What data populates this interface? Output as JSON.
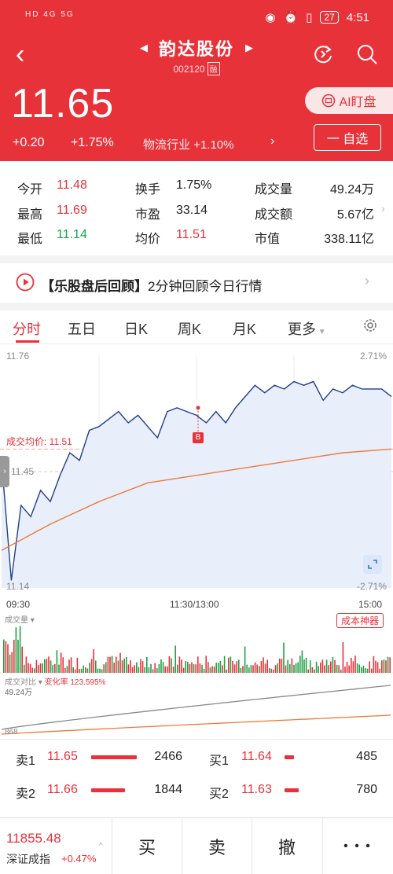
{
  "status_bar": {
    "left": "HD 4G 5G",
    "time": "4:51",
    "battery": "27"
  },
  "header": {
    "stock_name": "韵达股份",
    "stock_code": "002120",
    "margin_badge": "融",
    "price": "11.65",
    "change": "+0.20",
    "change_pct": "+1.75%",
    "industry": "物流行业",
    "industry_pct": "+1.10%",
    "ai_watch_label": "AI盯盘",
    "add_watch_label": "一 自选"
  },
  "stats": [
    {
      "label": "今开",
      "value": "11.48",
      "tone": "red"
    },
    {
      "label": "最高",
      "value": "11.69",
      "tone": "red"
    },
    {
      "label": "最低",
      "value": "11.14",
      "tone": "green"
    },
    {
      "label": "换手",
      "value": "1.75%",
      "tone": "plain"
    },
    {
      "label": "市盈",
      "value": "33.14",
      "tone": "plain"
    },
    {
      "label": "均价",
      "value": "11.51",
      "tone": "red"
    },
    {
      "label": "成交量",
      "value": "49.24万",
      "tone": "plain"
    },
    {
      "label": "成交额",
      "value": "5.67亿",
      "tone": "plain"
    },
    {
      "label": "市值",
      "value": "338.11亿",
      "tone": "plain"
    }
  ],
  "review": {
    "title": "【乐股盘后回顾】",
    "subtitle": "2分钟回顾今日行情"
  },
  "tabs": [
    "分时",
    "五日",
    "日K",
    "周K",
    "月K",
    "更多"
  ],
  "chart": {
    "y_top": "11.76",
    "y_mid": "11.45",
    "y_bottom": "11.14",
    "pct_top": "2.71%",
    "pct_bottom": "-2.71%",
    "avg_label": "成交均价: 11.51",
    "marker": "B",
    "time_start": "09:30",
    "time_mid": "11:30/13:00",
    "time_end": "15:00"
  },
  "chart_data": {
    "type": "line",
    "title": "",
    "ylim": [
      11.14,
      11.76
    ],
    "series": [
      {
        "name": "",
        "color": "#1f3f8a",
        "x": [
          "09:30",
          "09:36",
          "09:42",
          "09:48",
          "09:54",
          "10:00",
          "10:06",
          "10:12",
          "10:18",
          "10:24",
          "10:30",
          "10:36",
          "10:42",
          "10:48",
          "10:54",
          "11:00",
          "11:06",
          "11:12",
          "11:18",
          "11:24",
          "11:30",
          "13:06",
          "13:12",
          "13:18",
          "13:24",
          "13:30",
          "13:36",
          "13:42",
          "13:48",
          "13:54",
          "14:00",
          "14:06",
          "14:12",
          "14:18",
          "14:24",
          "14:30",
          "14:36",
          "14:42",
          "14:48",
          "14:54",
          "15:00"
        ],
        "values": [
          11.48,
          11.16,
          11.36,
          11.33,
          11.4,
          11.37,
          11.44,
          11.5,
          11.48,
          11.56,
          11.57,
          11.59,
          11.61,
          11.58,
          11.6,
          11.57,
          11.54,
          11.61,
          11.62,
          11.61,
          11.6,
          11.58,
          11.61,
          11.58,
          11.62,
          11.65,
          11.68,
          11.66,
          11.68,
          11.67,
          11.69,
          11.68,
          11.69,
          11.64,
          11.67,
          11.66,
          11.68,
          11.67,
          11.67,
          11.67,
          11.65
        ]
      },
      {
        "name": "成交均价",
        "color": "#f07a3a",
        "x": [
          "09:30",
          "10:00",
          "10:30",
          "11:00",
          "11:30",
          "13:30",
          "14:00",
          "14:30",
          "15:00"
        ],
        "values": [
          11.24,
          11.31,
          11.37,
          11.42,
          11.44,
          11.46,
          11.48,
          11.5,
          11.51
        ]
      }
    ]
  },
  "volume": {
    "label": "成交量",
    "cost_button": "成本神器"
  },
  "compare": {
    "label": "成交对比",
    "rate_label": "变化率 123.595%",
    "top_value": "49.24万",
    "bottom_value": "868"
  },
  "order_book": {
    "sell": [
      {
        "label": "卖1",
        "price": "11.65",
        "qty": "2466",
        "bar": 0.45
      },
      {
        "label": "卖2",
        "price": "11.66",
        "qty": "1844",
        "bar": 0.33
      }
    ],
    "buy": [
      {
        "label": "买1",
        "price": "11.64",
        "qty": "485",
        "bar": 0.09
      },
      {
        "label": "买2",
        "price": "11.63",
        "qty": "780",
        "bar": 0.14
      }
    ]
  },
  "bottom": {
    "index_value": "11855.48",
    "index_name": "深证成指",
    "index_pct": "+0.47%",
    "buy_label": "买",
    "sell_label": "卖",
    "cancel_label": "撤",
    "more_label": "• • •"
  }
}
